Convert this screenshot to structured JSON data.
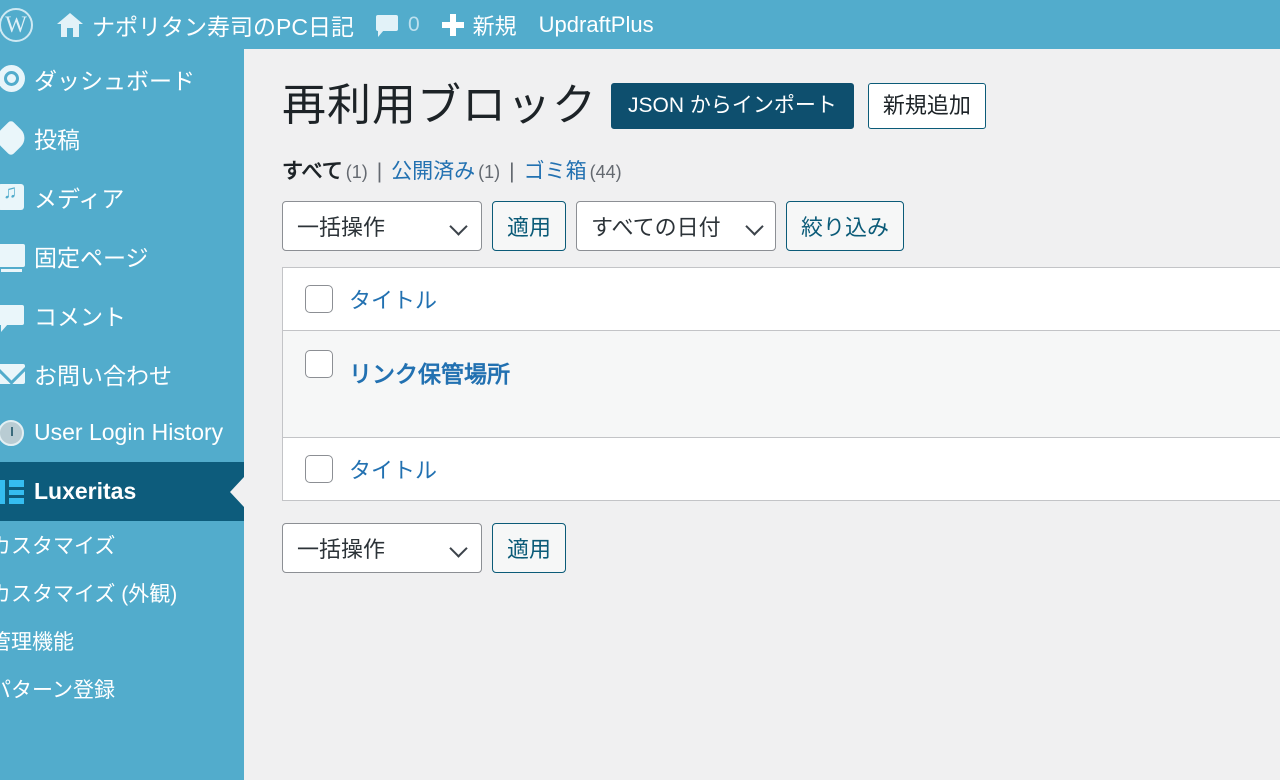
{
  "adminbar": {
    "logo_icon": "wordpress-logo-icon",
    "home_icon": "home-icon",
    "site_title": "ナポリタン寿司のPC日記",
    "comments_icon": "comment-bubble-icon",
    "comment_count": "0",
    "new_icon": "plus-icon",
    "new_label": "新規",
    "updraftplus_label": "UpdraftPlus"
  },
  "sidebar": {
    "items": [
      {
        "label": "ダッシュボード",
        "icon": "dashboard-icon"
      },
      {
        "label": "投稿",
        "icon": "pin-icon"
      },
      {
        "label": "メディア",
        "icon": "media-icon"
      },
      {
        "label": "固定ページ",
        "icon": "page-icon"
      },
      {
        "label": "コメント",
        "icon": "comment-icon"
      },
      {
        "label": "お問い合わせ",
        "icon": "mail-icon"
      },
      {
        "label": "User Login History",
        "icon": "clock-icon"
      },
      {
        "label": "Luxeritas",
        "icon": "luxeritas-icon",
        "current": true
      }
    ],
    "submenu": [
      {
        "label": "カスタマイズ"
      },
      {
        "label": "カスタマイズ (外観)"
      },
      {
        "label": "管理機能"
      },
      {
        "label": "パターン登録"
      }
    ]
  },
  "page": {
    "title": "再利用ブロック",
    "import_button": "JSON からインポート",
    "add_new_button": "新規追加"
  },
  "views": {
    "all_label": "すべて",
    "all_count": "(1)",
    "published_label": "公開済み",
    "published_count": "(1)",
    "trash_label": "ゴミ箱",
    "trash_count": "(44)",
    "separator": "|"
  },
  "tablenav_top": {
    "bulk_action_value": "一括操作",
    "apply_label": "適用",
    "date_filter_value": "すべての日付",
    "filter_label": "絞り込み",
    "chevron_icon": "chevron-down-icon"
  },
  "tablenav_bottom": {
    "bulk_action_value": "一括操作",
    "apply_label": "適用",
    "chevron_icon": "chevron-down-icon"
  },
  "table": {
    "header_title": "タイトル",
    "footer_title": "タイトル",
    "checkbox_icon": "checkbox-icon",
    "rows": [
      {
        "title": "リンク保管場所"
      }
    ]
  },
  "colors": {
    "adminbar_bg": "#52accc",
    "sidebar_bg": "#52accc",
    "sidebar_current_bg": "#0d5c7c",
    "content_bg": "#f0f0f1",
    "link": "#2271b1",
    "primary_button_bg": "#0e4f6e",
    "row_alt_bg": "#f6f7f7"
  }
}
